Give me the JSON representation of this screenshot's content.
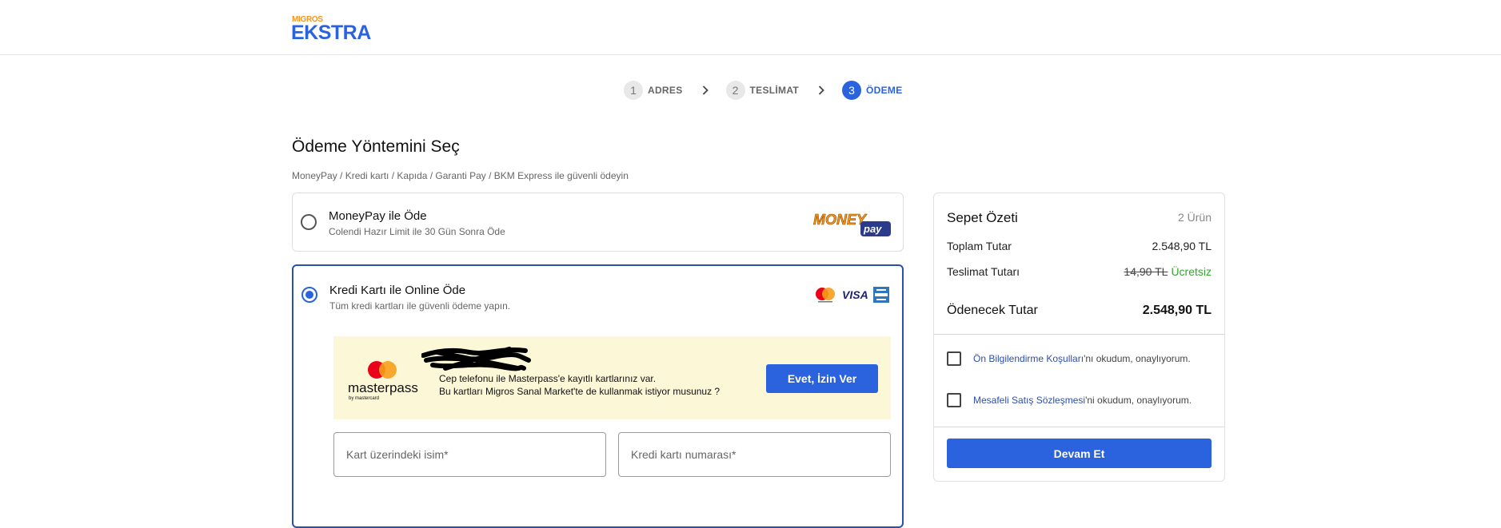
{
  "brand": {
    "top": "MIGROS",
    "main": "EKSTRA"
  },
  "steps": [
    {
      "num": "1",
      "label": "ADRES"
    },
    {
      "num": "2",
      "label": "TESLİMAT"
    },
    {
      "num": "3",
      "label": "ÖDEME"
    }
  ],
  "page": {
    "title": "Ödeme Yöntemini Seç",
    "subtitle": "MoneyPay / Kredi kartı / Kapıda / Garanti Pay / BKM Express ile güvenli ödeyin"
  },
  "moneypay": {
    "title": "MoneyPay ile Öde",
    "subtitle": "Colendi Hazır Limit ile 30 Gün Sonra Öde",
    "logo_main": "MONEY",
    "logo_sub": "pay"
  },
  "credit": {
    "title": "Kredi Kartı ile Online Öde",
    "subtitle": "Tüm kredi kartları ile güvenli ödeme yapın.",
    "visa": "VISA",
    "masterpass": {
      "logo": "masterpass",
      "logo_sub": "by mastercard",
      "line1": "Cep telefonu ile Masterpass'e kayıtlı kartlarınız var.",
      "line2": "Bu kartları Migros Sanal Market'te de kullanmak istiyor musunuz ?",
      "button": "Evet, İzin Ver"
    },
    "name_placeholder": "Kart üzerindeki isim*",
    "number_placeholder": "Kredi kartı numarası*"
  },
  "summary": {
    "title": "Sepet Özeti",
    "count": "2 Ürün",
    "total_label": "Toplam Tutar",
    "total_value": "2.548,90 TL",
    "delivery_label": "Teslimat Tutarı",
    "delivery_old": "14,90 TL",
    "delivery_free": "Ücretsiz",
    "payable_label": "Ödenecek Tutar",
    "payable_value": "2.548,90 TL",
    "check1_link": "Ön Bilgilendirme Koşulları",
    "check1_rest": "'nı okudum, onaylıyorum.",
    "check2_link": "Mesafeli Satış Sözleşmesi",
    "check2_rest": "'ni okudum, onaylıyorum.",
    "button": "Devam Et"
  },
  "colors": {
    "accent": "#2a63dd",
    "free": "#36a334",
    "banner": "#fcf7d7"
  }
}
